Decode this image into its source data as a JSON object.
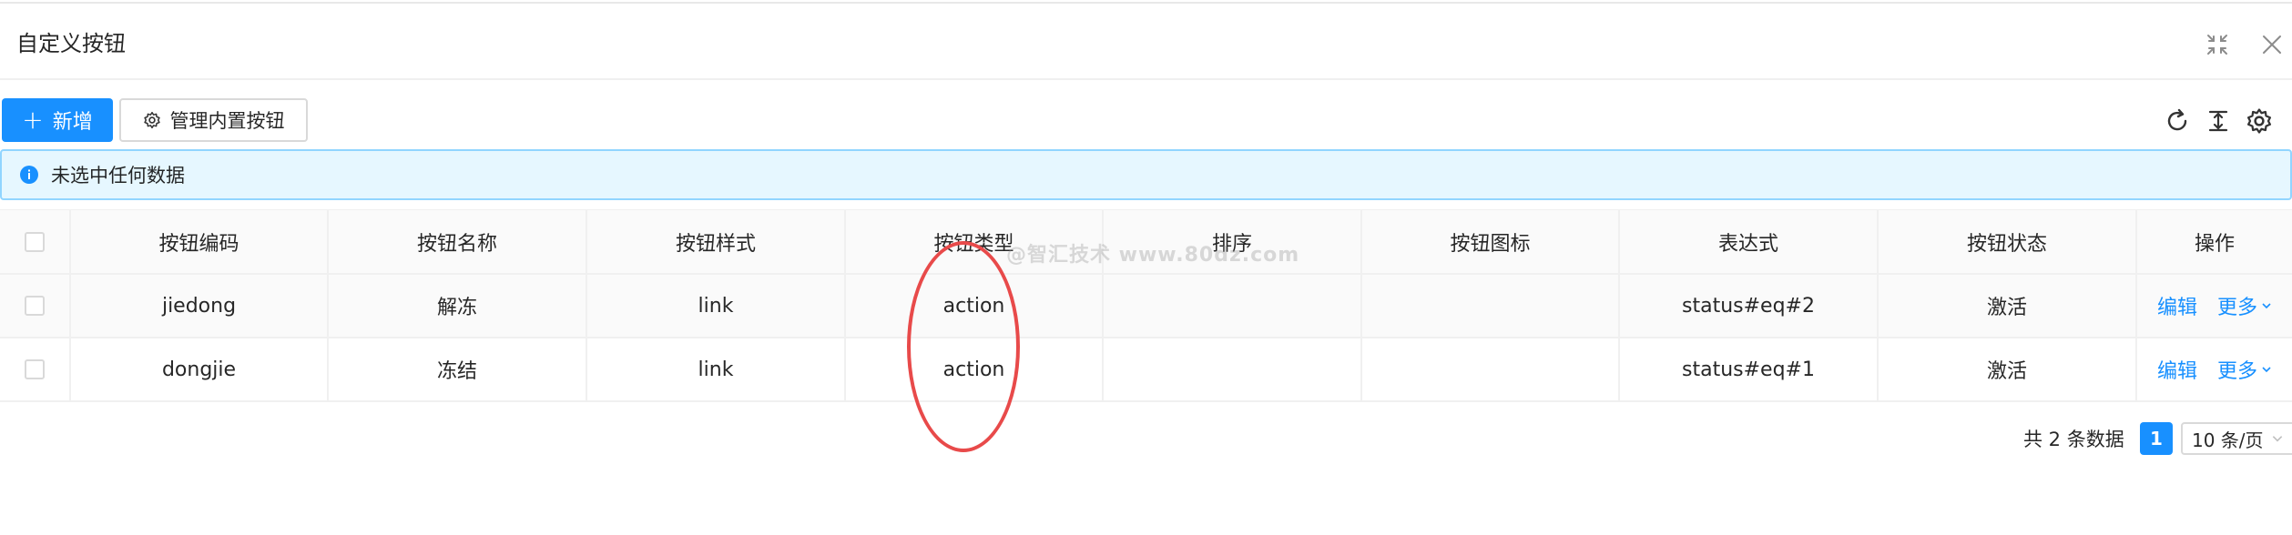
{
  "header": {
    "title": "自定义按钮"
  },
  "toolbar": {
    "add_label": "新增",
    "manage_label": "管理内置按钮"
  },
  "alert": {
    "text": "未选中任何数据"
  },
  "table": {
    "columns": [
      "按钮编码",
      "按钮名称",
      "按钮样式",
      "按钮类型",
      "排序",
      "按钮图标",
      "表达式",
      "按钮状态",
      "操作"
    ],
    "rows": [
      {
        "code": "jiedong",
        "name": "解冻",
        "style": "link",
        "type": "action",
        "sort": "",
        "icon": "",
        "expr": "status#eq#2",
        "status": "激活"
      },
      {
        "code": "dongjie",
        "name": "冻结",
        "style": "link",
        "type": "action",
        "sort": "",
        "icon": "",
        "expr": "status#eq#1",
        "status": "激活"
      }
    ],
    "edit_label": "编辑",
    "more_label": "更多"
  },
  "pagination": {
    "total": "共 2 条数据",
    "current_page": "1",
    "page_size": "10 条/页"
  },
  "watermark": "@智汇技术 www.80dz.com",
  "colors": {
    "primary": "#1890ff",
    "alert_bg": "#e6f7ff",
    "alert_border": "#91d5ff",
    "annotation": "#e84a4a"
  }
}
